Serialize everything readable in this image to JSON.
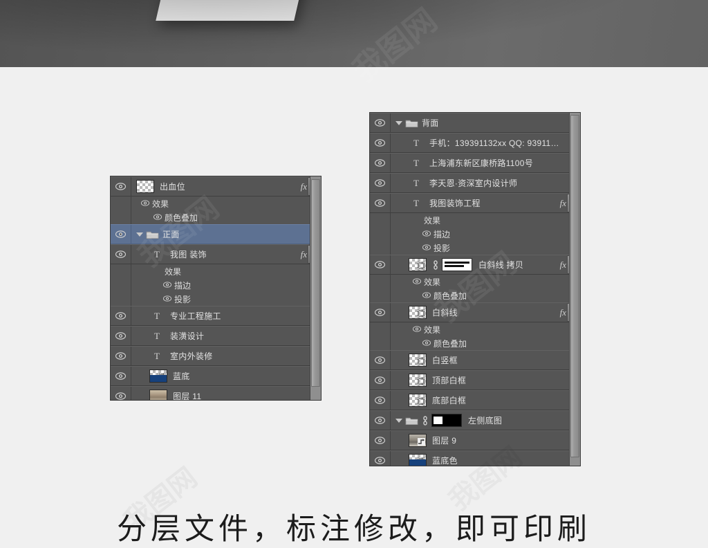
{
  "caption": {
    "text": "分层文件，标注修改，即可印刷"
  },
  "colors": {
    "panel_bg": "#535353",
    "row_bg": "#555555",
    "row_selected": "#5d7192",
    "text": "#e2e2e2",
    "band": "#606060",
    "page_bg": "#f0f0f0",
    "scrollbar": "#8f8f8f"
  },
  "top_band": {
    "shape": "paper-corner-triangle"
  },
  "left_panel": {
    "name": "layers-panel-front",
    "scroll_position": "middle",
    "rows": [
      {
        "id": "chuxuewei",
        "label": "出血位",
        "kind": "pixel",
        "thumb": "transparent",
        "visible": true,
        "selected": false,
        "has_fx": true,
        "indent": 0,
        "effects": [
          {
            "label": "效果",
            "indent": 1,
            "visible": true
          },
          {
            "label": "颜色叠加",
            "indent": 2,
            "visible": true
          }
        ]
      },
      {
        "id": "zhengmian",
        "label": "正面",
        "kind": "group",
        "thumb": "folder",
        "visible": true,
        "selected": true,
        "expanded": true,
        "has_fx": false,
        "indent": 0,
        "effects": []
      },
      {
        "id": "wotu-zhuangshi",
        "label": "我图 装饰",
        "kind": "text",
        "thumb": "T",
        "visible": true,
        "selected": false,
        "has_fx": true,
        "indent": 1,
        "effects": [
          {
            "label": "效果",
            "indent": 2,
            "visible": false
          },
          {
            "label": "描边",
            "indent": 3,
            "visible": true
          },
          {
            "label": "投影",
            "indent": 3,
            "visible": true
          }
        ]
      },
      {
        "id": "zhuanye-gongcheng-shigong",
        "label": "专业工程施工",
        "kind": "text",
        "thumb": "T",
        "visible": true,
        "selected": false,
        "has_fx": false,
        "indent": 1,
        "effects": []
      },
      {
        "id": "zhuanghuang-sheji",
        "label": "装潢设计",
        "kind": "text",
        "thumb": "T",
        "visible": true,
        "selected": false,
        "has_fx": false,
        "indent": 1,
        "effects": []
      },
      {
        "id": "shineiwai-zhuangxiu",
        "label": "室内外装修",
        "kind": "text",
        "thumb": "T",
        "visible": true,
        "selected": false,
        "has_fx": false,
        "indent": 1,
        "effects": []
      },
      {
        "id": "landi",
        "label": "蓝底",
        "kind": "shape",
        "thumb": "blue-vector",
        "visible": true,
        "selected": false,
        "has_fx": false,
        "indent": 1,
        "effects": []
      },
      {
        "id": "tuceng-11",
        "label": "图层 11",
        "kind": "pixel",
        "thumb": "photo",
        "visible": true,
        "selected": false,
        "has_fx": false,
        "indent": 1,
        "effects": []
      }
    ]
  },
  "right_panel": {
    "name": "layers-panel-back",
    "scroll_position": "top",
    "rows": [
      {
        "id": "beimian",
        "label": "背面",
        "kind": "group",
        "thumb": "folder",
        "visible": true,
        "expanded": true,
        "has_fx": false,
        "indent": 0,
        "effects": []
      },
      {
        "id": "shouji",
        "label": "手机：139391132xx   QQ: 93911…",
        "kind": "text",
        "thumb": "T",
        "visible": true,
        "has_fx": false,
        "indent": 1,
        "effects": []
      },
      {
        "id": "dizhi",
        "label": "上海浦东新区康桥路1100号",
        "kind": "text",
        "thumb": "T",
        "visible": true,
        "has_fx": false,
        "indent": 1,
        "effects": []
      },
      {
        "id": "sheji-shi",
        "label": "李天恩·资深室内设计师",
        "kind": "text",
        "thumb": "T",
        "visible": true,
        "has_fx": false,
        "indent": 1,
        "effects": []
      },
      {
        "id": "wotu-zhuangshi-gongcheng",
        "label": "我图装饰工程",
        "kind": "text",
        "thumb": "T",
        "visible": true,
        "has_fx": true,
        "indent": 1,
        "effects": [
          {
            "label": "效果",
            "indent": 2,
            "visible": false
          },
          {
            "label": "描边",
            "indent": 3,
            "visible": true
          },
          {
            "label": "投影",
            "indent": 3,
            "visible": true
          }
        ]
      },
      {
        "id": "baixiexian-kaobei",
        "label": "白斜线 拷贝",
        "kind": "pixel-masked",
        "thumb": "transparent-vector",
        "mask": "bars",
        "linked": true,
        "visible": true,
        "has_fx": true,
        "indent": 1,
        "effects": [
          {
            "label": "效果",
            "indent": 2,
            "visible": true
          },
          {
            "label": "颜色叠加",
            "indent": 3,
            "visible": true
          }
        ]
      },
      {
        "id": "baixiexian",
        "label": "白斜线",
        "kind": "pixel",
        "thumb": "transparent-vector",
        "visible": true,
        "has_fx": true,
        "indent": 1,
        "effects": [
          {
            "label": "效果",
            "indent": 2,
            "visible": true
          },
          {
            "label": "颜色叠加",
            "indent": 3,
            "visible": true
          }
        ]
      },
      {
        "id": "baishukuang",
        "label": "白竖框",
        "kind": "shape",
        "thumb": "transparent-vector",
        "visible": true,
        "has_fx": false,
        "indent": 1,
        "effects": []
      },
      {
        "id": "dingbu-baikuang",
        "label": "顶部白框",
        "kind": "shape",
        "thumb": "transparent-vector",
        "visible": true,
        "has_fx": false,
        "indent": 1,
        "effects": []
      },
      {
        "id": "dibu-baikuang",
        "label": "底部白框",
        "kind": "shape",
        "thumb": "transparent-vector",
        "visible": true,
        "has_fx": false,
        "indent": 1,
        "effects": []
      },
      {
        "id": "zuoce-ditu",
        "label": "左侧底图",
        "kind": "group-masked",
        "thumb": "folder",
        "mask": "blackwhite",
        "linked": true,
        "expanded": true,
        "visible": true,
        "has_fx": false,
        "indent": 0,
        "effects": []
      },
      {
        "id": "tuceng-9",
        "label": "图层 9",
        "kind": "pixel",
        "thumb": "photo2",
        "visible": true,
        "has_fx": false,
        "indent": 1,
        "effects": []
      },
      {
        "id": "landise",
        "label": "蓝底色",
        "kind": "shape",
        "thumb": "blue-vector",
        "visible": true,
        "has_fx": false,
        "indent": 1,
        "effects": []
      }
    ]
  },
  "watermarks": [
    "我图网",
    "我图网",
    "我图网",
    "我图网"
  ]
}
